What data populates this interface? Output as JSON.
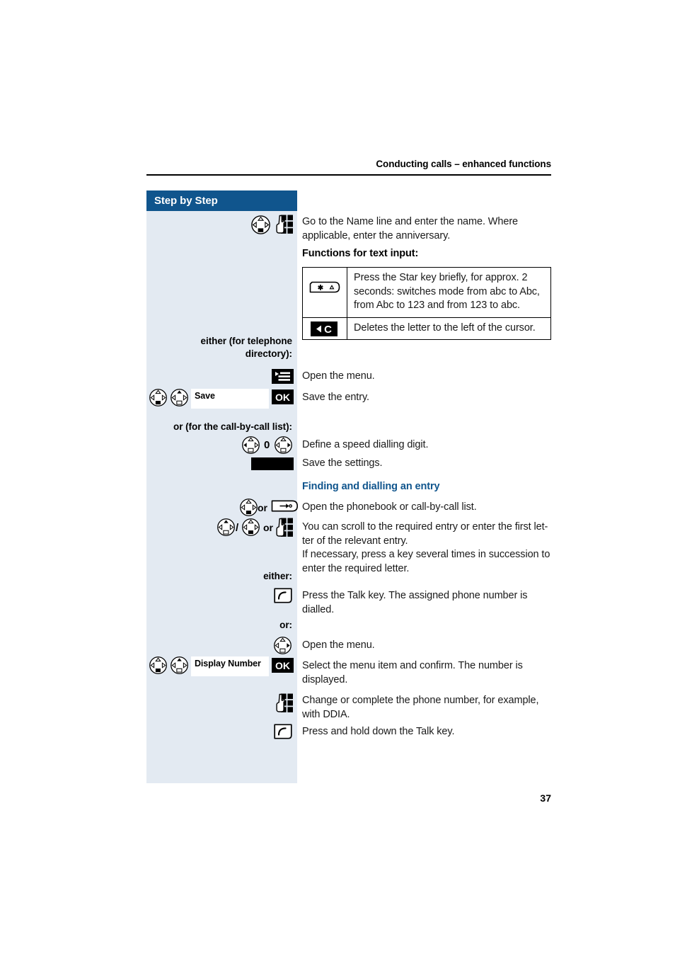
{
  "document": {
    "running_header": "Conducting calls – enhanced functions",
    "page_number": "37",
    "sidebar_title": "Step by Step",
    "accent_blue": "#10558d",
    "sidebar_bg": "#e3eaf2"
  },
  "steps": [
    {
      "id": "enter-name",
      "icons": [
        "nav-key-down-icon",
        "keypad-hand-icon"
      ],
      "text": "Go to the Name line and enter the name. Where applicable, enter the anniversary."
    },
    {
      "id": "functions-heading",
      "text": "Functions for text input:"
    }
  ],
  "functions_table": {
    "rows": [
      {
        "icon": "star-key-icon",
        "icon_label": "*",
        "text": "Press the Star key briefly, for approx. 2 seconds: switches mode from abc to Abc, from Abc to 123 and from 123 to abc."
      },
      {
        "icon": "delete-key-icon",
        "icon_label": "C",
        "text": "Deletes the letter to the left of the cursor."
      }
    ]
  },
  "left_labels": {
    "either_telephone_directory": "either (for telephone\ndirectory):",
    "either_telephone_directory_l1": "either (for telephone",
    "either_telephone_directory_l2": "directory):",
    "or_call_by_call": "or (for the call-by-call list):",
    "either": "either:",
    "or": "or:"
  },
  "directory_block": {
    "open_menu": {
      "icon": "menu-key-icon",
      "text": "Open the menu."
    },
    "save_entry": {
      "icons": [
        "nav-key-down-icon",
        "nav-key-up-icon"
      ],
      "softkey_label": "Save",
      "confirm_label": "OK",
      "text": "Save the entry."
    }
  },
  "call_by_call_block": {
    "speed_dial": {
      "icons": [
        "nav-key-left-icon",
        "nav-key-right-icon"
      ],
      "digit": "0",
      "text": "Define a speed dialling digit."
    },
    "save_settings": {
      "icon": "blank-softkey-bar",
      "text": "Save the settings."
    }
  },
  "finding_section": {
    "heading": "Finding and dialling an entry",
    "open_phonebook": {
      "icons": [
        "nav-key-down-icon",
        "directory-key-icon"
      ],
      "or_label": "or",
      "text": "Open the phonebook or call-by-call list."
    },
    "scroll_entry": {
      "icons": [
        "nav-key-up-icon",
        "nav-key-down-icon",
        "keypad-hand-icon"
      ],
      "separator": "/",
      "or_label": "or",
      "text": "You can scroll to the required entry or enter the first letter of the relevant entry.\nIf necessary, press a key several times in succession to enter the required letter.",
      "text_l1": "You can scroll to the required entry or enter the first let-",
      "text_l2": "ter of the relevant entry.",
      "text_l3": "If necessary, press a key several times in succession to",
      "text_l4": "enter the required letter."
    },
    "talk_key": {
      "icon": "talk-key-icon",
      "text": "Press the Talk key. The assigned phone number is dialled."
    },
    "open_menu": {
      "icon": "nav-key-right-icon",
      "text": "Open the menu."
    },
    "display_number": {
      "icons": [
        "nav-key-down-icon",
        "nav-key-up-icon"
      ],
      "softkey_label": "Display Number",
      "confirm_label": "OK",
      "text": "Select the menu item and confirm. The number is displayed."
    },
    "change_number": {
      "icon": "keypad-hand-icon",
      "text": "Change or complete the phone number, for example, with DDIA."
    },
    "hold_talk_key": {
      "icon": "talk-key-icon",
      "text": "Press and hold down the Talk key."
    }
  }
}
